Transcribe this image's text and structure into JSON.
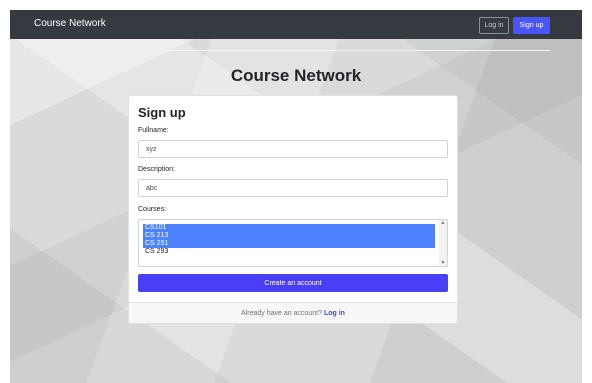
{
  "navbar": {
    "brand": "Course Network",
    "login_label": "Log in",
    "signup_label": "Sign up"
  },
  "page": {
    "title": "Course Network"
  },
  "form": {
    "heading": "Sign up",
    "fullname_label": "Fullname:",
    "fullname_value": "xyz",
    "description_label": "Description:",
    "description_value": "abc",
    "courses_label": "Courses:",
    "courses": [
      {
        "label": "CS101",
        "selected": true
      },
      {
        "label": "CS 213",
        "selected": true
      },
      {
        "label": "CS 251",
        "selected": true
      },
      {
        "label": "CS 293",
        "selected": false
      }
    ],
    "submit_label": "Create an account"
  },
  "footer": {
    "prompt": "Already have an account?",
    "login_link": "Log in"
  },
  "colors": {
    "navbar_bg": "#343a40",
    "accent": "#4a3ff5",
    "selected_option": "#4f82ff"
  }
}
